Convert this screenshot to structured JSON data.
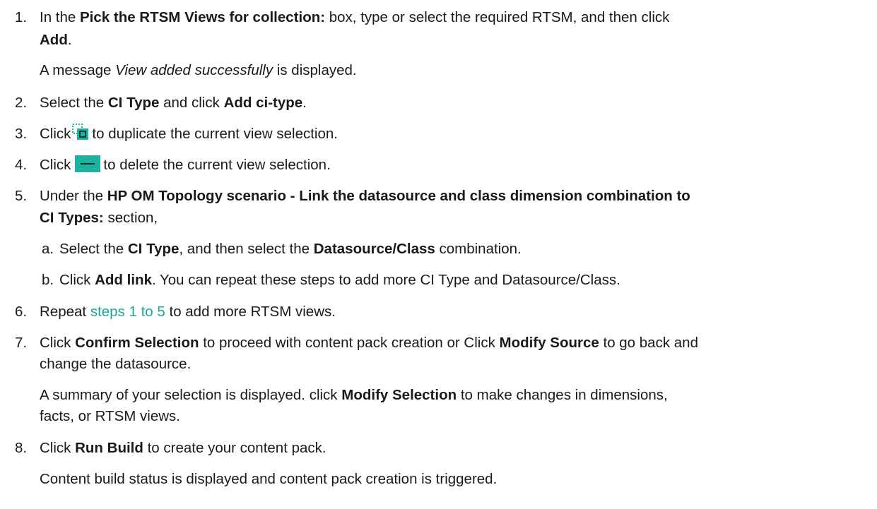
{
  "steps": [
    {
      "num": "1.",
      "l1": {
        "a": "In the ",
        "b": "Pick the RTSM Views for collection:",
        "c": " box, type or select the required RTSM, and then click"
      },
      "l2": {
        "b": "Add",
        "c": "."
      },
      "note": {
        "a": "A message ",
        "i": "View added successfully",
        "c": " is displayed."
      }
    },
    {
      "num": "2.",
      "l1": {
        "a": "Select the ",
        "b1": "CI Type",
        "c": " and click ",
        "b2": "Add ci-type",
        "d": "."
      }
    },
    {
      "num": "3.",
      "l1": {
        "a": "Click",
        "icon": "duplicate-icon",
        "c": "to duplicate the current view selection."
      }
    },
    {
      "num": "4.",
      "l1": {
        "a": "Click",
        "icon": "delete-icon",
        "c": "to delete the current view selection."
      }
    },
    {
      "num": "5.",
      "l1": {
        "a": "Under the ",
        "b": "HP OM Topology scenario - Link the datasource and class dimension combination to"
      },
      "l2": {
        "b": "CI Types:",
        "c": " section,"
      },
      "subs": [
        {
          "label": "a.",
          "a": "Select the ",
          "b1": "CI Type",
          "c": ", and then select the ",
          "b2": "Datasource/Class",
          "d": " combination."
        },
        {
          "label": "b.",
          "a": "Click ",
          "b1": "Add link",
          "c": ". You can repeat these steps to add more CI Type and Datasource/Class."
        }
      ]
    },
    {
      "num": "6.",
      "l1": {
        "a": "Repeat ",
        "link": "steps 1 to 5",
        "c": " to add more RTSM views."
      }
    },
    {
      "num": "7.",
      "l1": {
        "a": "Click ",
        "b1": "Confirm Selection",
        "c": " to proceed with content pack creation or Click ",
        "b2": "Modify Source",
        "d": " to go back and"
      },
      "l2": {
        "c": "change the datasource."
      },
      "note1": {
        "a": "A summary of your selection is displayed. click ",
        "b": "Modify Selection",
        "c": " to make changes in dimensions,"
      },
      "note2": {
        "c": "facts, or RTSM views."
      }
    },
    {
      "num": "8.",
      "l1": {
        "a": "Click ",
        "b": "Run Build",
        "c": " to create your content pack."
      },
      "note": {
        "c": "Content build status is displayed and content pack creation is triggered."
      }
    }
  ],
  "colors": {
    "link": "#1aa898",
    "icon_green": "#19b39f",
    "text": "#1a1a1a"
  }
}
